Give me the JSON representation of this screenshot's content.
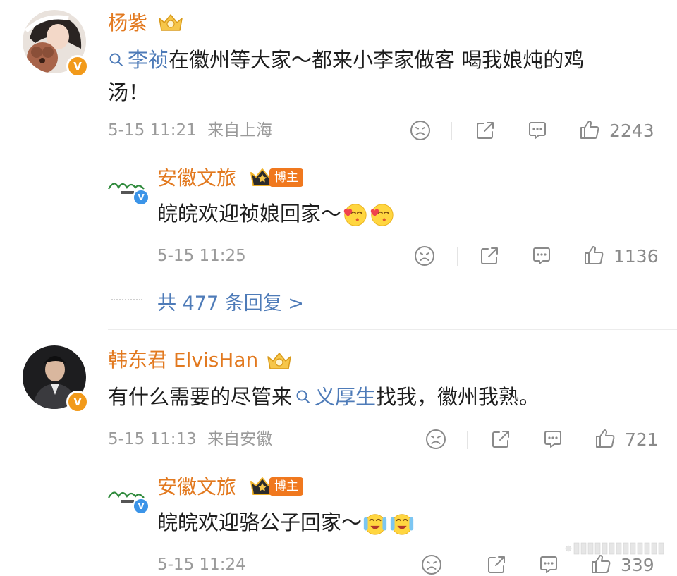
{
  "comments": [
    {
      "author": "杨紫",
      "text_parts": {
        "link": "李祯",
        "rest_line1": "在徽州等大家～都来小李家做客 喝我娘炖的鸡",
        "line2": "汤！"
      },
      "time": "5-15 11:21",
      "location": "来自上海",
      "likes": "2243",
      "reply": {
        "author": "安徽文旅",
        "badge": "博主",
        "text": "皖皖欢迎祯娘回家～",
        "time": "5-15 11:25",
        "likes": "1136"
      },
      "more_replies": "共 477 条回复 >"
    },
    {
      "author": "韩东君 ElvisHan",
      "text_parts": {
        "before": "有什么需要的尽管来",
        "link": "义厚生",
        "after": "找我，徽州我熟。"
      },
      "time": "5-15 11:13",
      "location": "来自安徽",
      "likes": "721",
      "reply": {
        "author": "安徽文旅",
        "badge": "博主",
        "text": "皖皖欢迎骆公子回家～",
        "time": "5-15 11:24",
        "likes": "339"
      }
    }
  ],
  "badges": {
    "verified_v": "V"
  },
  "colors": {
    "username": "#e2791f",
    "link": "#4e7bb8",
    "meta": "#9a9a9a",
    "blogger_tag": "#f0781e"
  },
  "icons": [
    "search-icon",
    "vip-crown-icon",
    "dislike-face-icon",
    "share-icon",
    "comment-icon",
    "like-icon",
    "blogger-crown-icon"
  ]
}
